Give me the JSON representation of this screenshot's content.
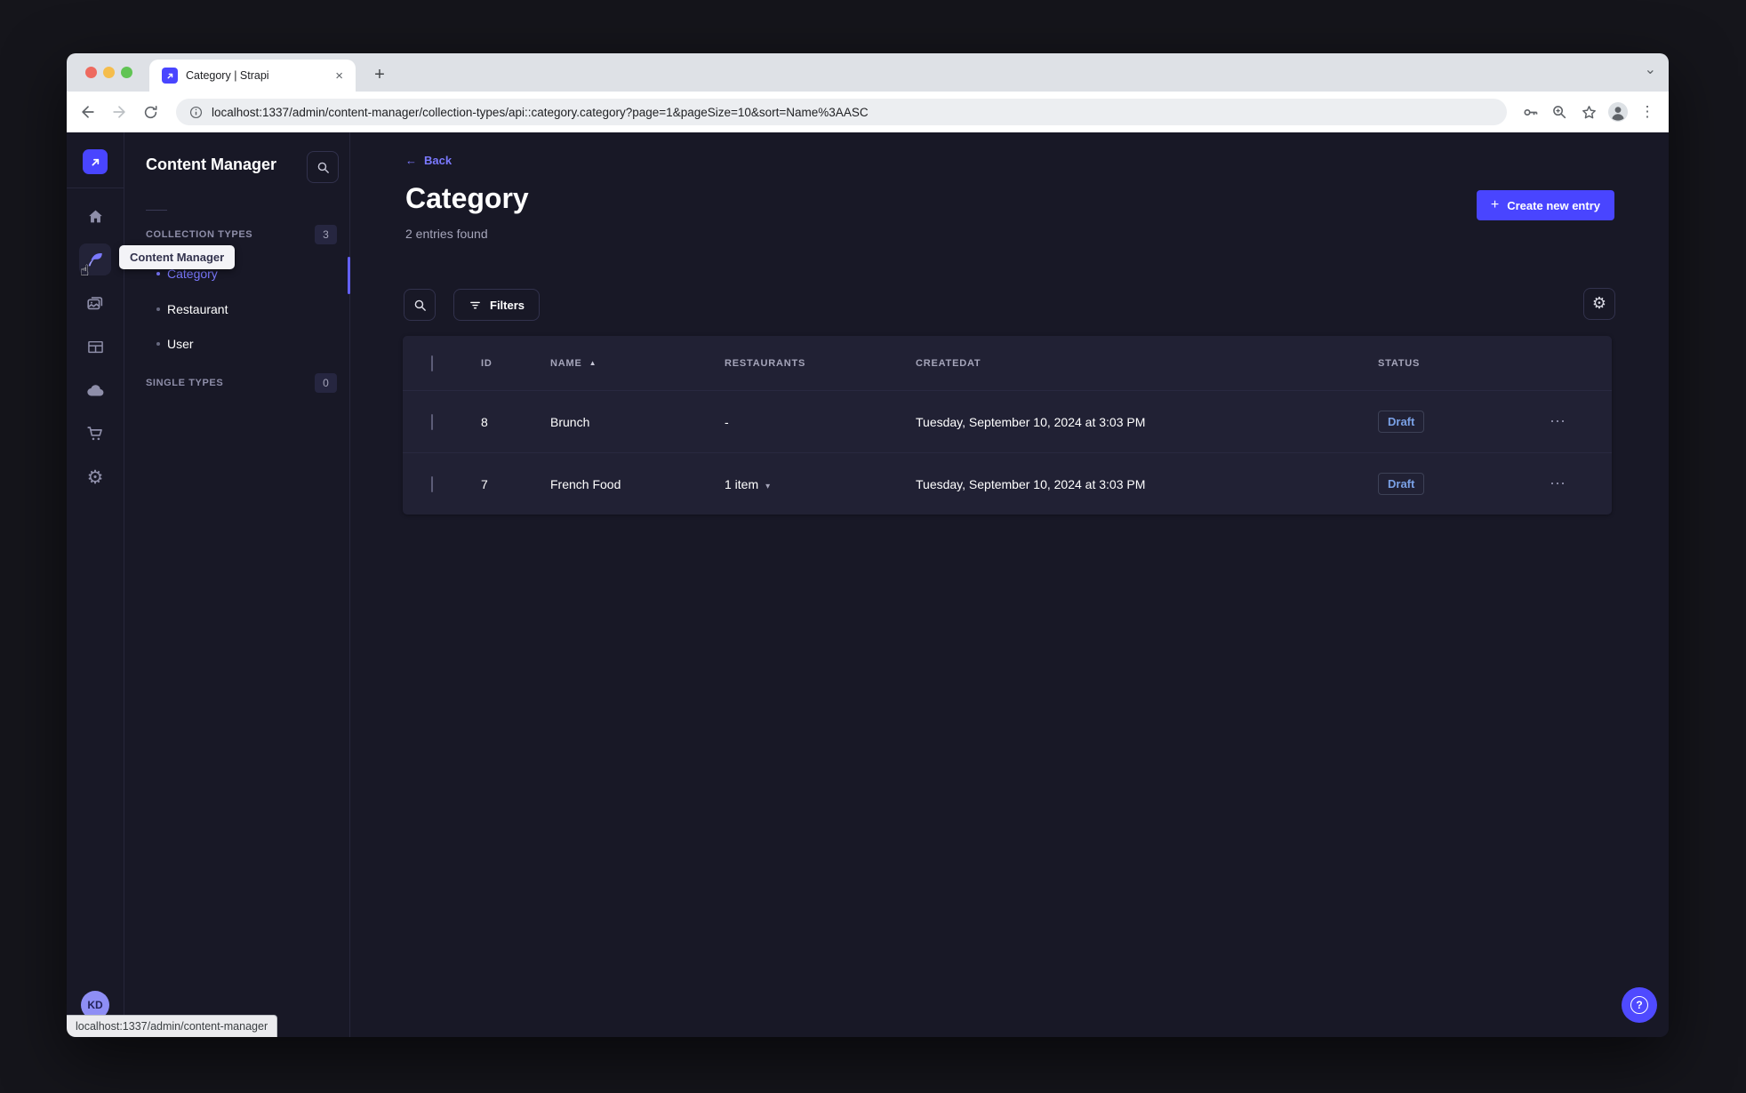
{
  "browser": {
    "tab_title": "Category | Strapi",
    "url": "localhost:1337/admin/content-manager/collection-types/api::category.category?page=1&pageSize=10&sort=Name%3AASC",
    "status_link": "localhost:1337/admin/content-manager"
  },
  "icons": {
    "plus": "+",
    "close": "×",
    "chevron_down": "⌄",
    "dots_vertical": "⋮",
    "ellipsis": "⋯",
    "back_arrow": "←",
    "sort_asc": "▲",
    "caret_down": "▾",
    "cursor_hand": "☝",
    "gear": "⚙",
    "question": "?"
  },
  "sidebar": {
    "tooltip": "Content Manager",
    "avatar_initials": "KD"
  },
  "panel": {
    "title": "Content Manager",
    "sections": [
      {
        "label": "COLLECTION TYPES",
        "count": "3",
        "items": [
          {
            "label": "Category"
          },
          {
            "label": "Restaurant"
          },
          {
            "label": "User"
          }
        ]
      },
      {
        "label": "SINGLE TYPES",
        "count": "0",
        "items": []
      }
    ]
  },
  "main": {
    "back_label": "Back",
    "title": "Category",
    "subtitle": "2 entries found",
    "create_button": "Create new entry",
    "filters_button": "Filters"
  },
  "table": {
    "headers": [
      "ID",
      "NAME",
      "RESTAURANTS",
      "CREATEDAT",
      "STATUS"
    ],
    "rows": [
      {
        "id": "8",
        "name": "Brunch",
        "restaurants": "-",
        "created_at": "Tuesday, September 10, 2024 at 3:03 PM",
        "status": "Draft"
      },
      {
        "id": "7",
        "name": "French Food",
        "restaurants": "1 item",
        "created_at": "Tuesday, September 10, 2024 at 3:03 PM",
        "status": "Draft"
      }
    ]
  },
  "colors": {
    "primary": "#4945ff",
    "primary_light": "#7b79ff",
    "draft_text": "#7aa1e6"
  }
}
